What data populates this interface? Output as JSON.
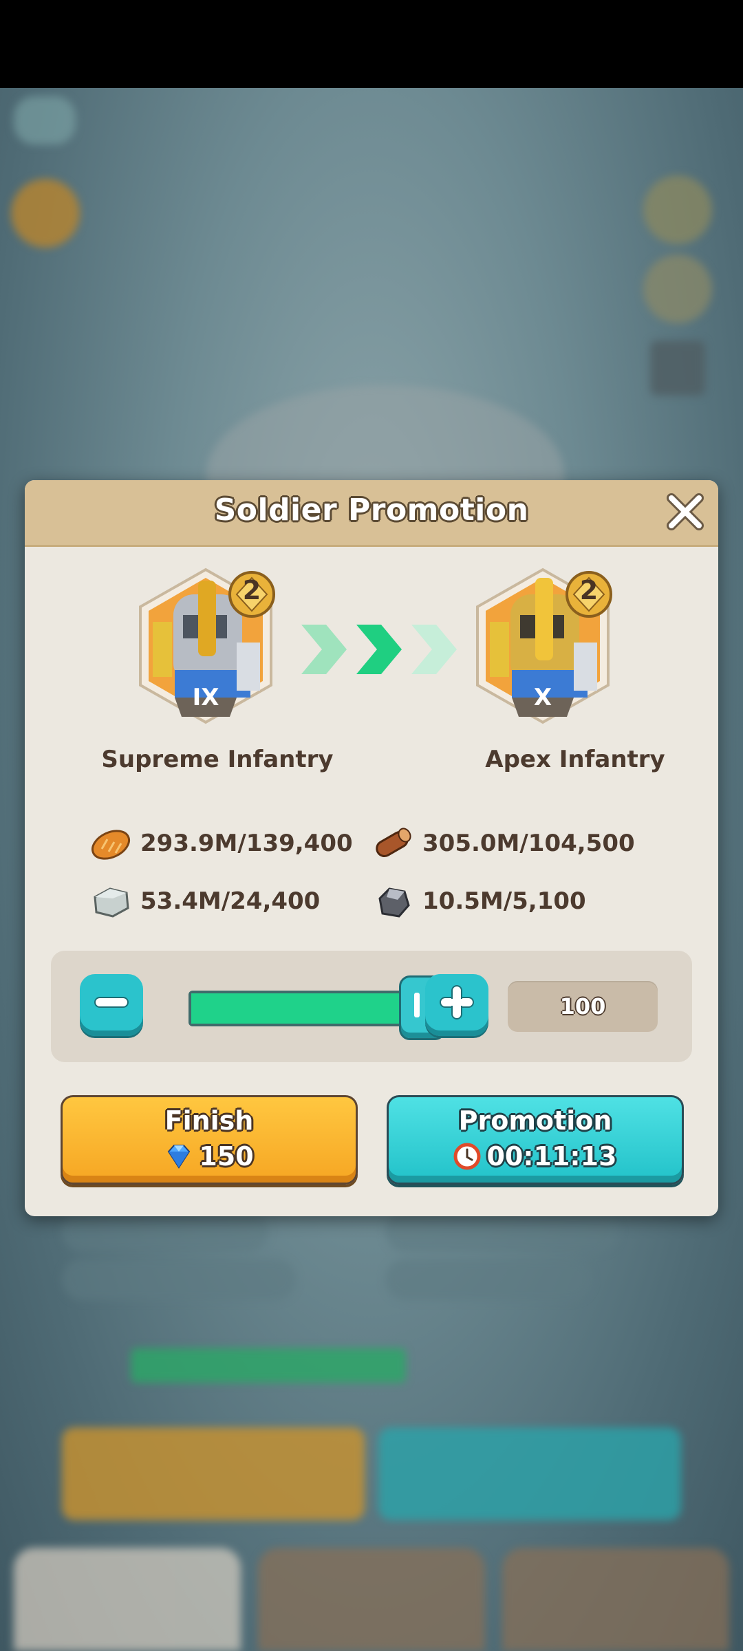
{
  "dialog": {
    "title": "Soldier Promotion"
  },
  "current_unit": {
    "name": "Supreme Infantry",
    "tier": "IX",
    "level_badge": "2"
  },
  "next_unit": {
    "name": "Apex Infantry",
    "tier": "X",
    "level_badge": "2"
  },
  "resources": [
    {
      "icon": "bread-icon",
      "value": "293.9M/139,400"
    },
    {
      "icon": "wood-log-icon",
      "value": "305.0M/104,500"
    },
    {
      "icon": "stone-icon",
      "value": "53.4M/24,400"
    },
    {
      "icon": "iron-ore-icon",
      "value": "10.5M/5,100"
    }
  ],
  "quantity": {
    "value": "100",
    "slider_fraction": 1.0
  },
  "buttons": {
    "finish_label": "Finish",
    "finish_cost": "150",
    "promotion_label": "Promotion",
    "promotion_time": "00:11:13"
  },
  "colors": {
    "header": "#d8c096",
    "panel": "#ece8e0",
    "finish_button": "#f6a623",
    "promotion_button": "#22c2c9",
    "slider_fill": "#1fd28a"
  }
}
